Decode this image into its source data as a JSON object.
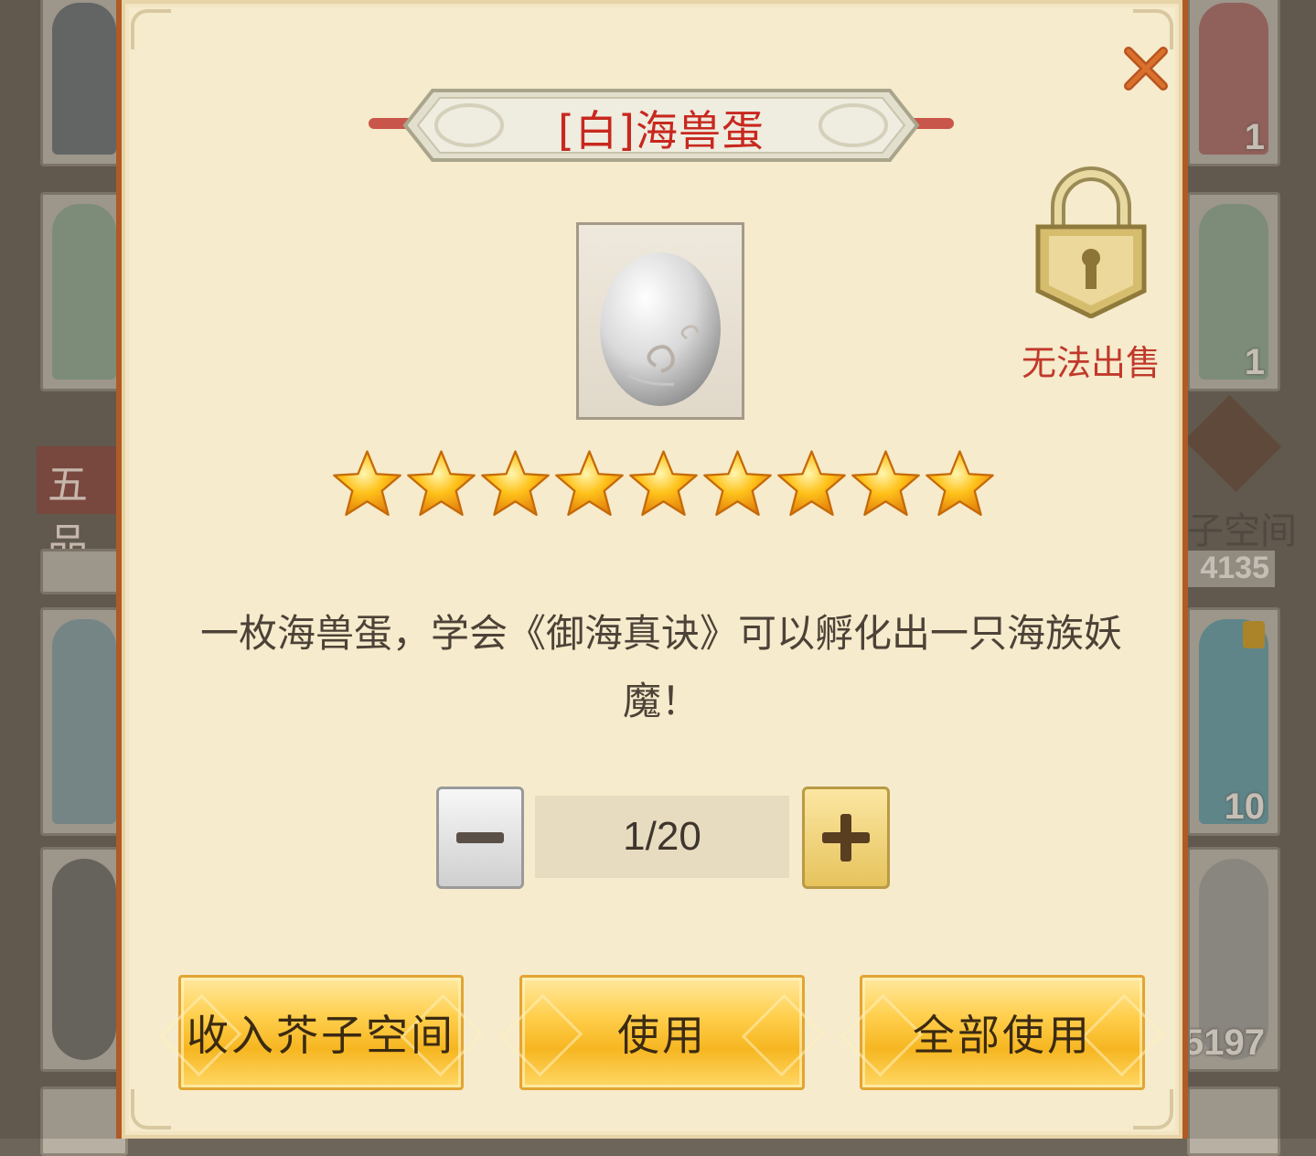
{
  "background": {
    "left_tag": "五品",
    "right_label": "子空间",
    "right_counts": [
      "1",
      "1",
      "4135",
      "10",
      "5197"
    ]
  },
  "dialog": {
    "title": "[白]海兽蛋",
    "item_icon": "white-egg-icon",
    "lock_icon": "gold-lock-icon",
    "lock_label": "无法出售",
    "star_count": 9,
    "description": "一枚海兽蛋，学会《御海真诀》可以孵化出一只海族妖魔！",
    "quantity": {
      "value": "1/20",
      "minus_icon": "minus-icon",
      "plus_icon": "plus-icon"
    },
    "buttons": {
      "store": "收入芥子空间",
      "use": "使用",
      "use_all": "全部使用"
    },
    "close_icon": "close-icon"
  },
  "colors": {
    "panel": "#f6ebcc",
    "border": "#b05a26",
    "title_red": "#c8281e",
    "lock_red": "#c0392b",
    "button_gold": "#f6b621",
    "text_dark": "#4c4237"
  }
}
